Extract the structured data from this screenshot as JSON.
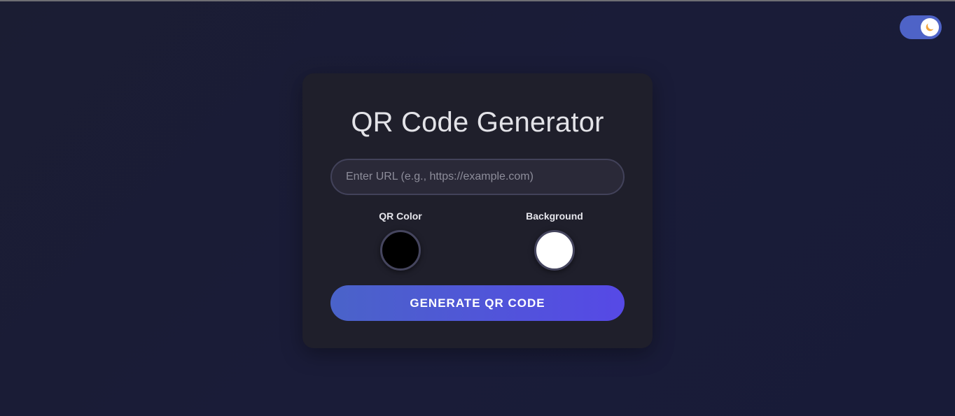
{
  "theme_toggle": {
    "icon": "moon-icon",
    "state": "dark"
  },
  "card": {
    "title": "QR Code Generator",
    "url_input": {
      "placeholder": "Enter URL (e.g., https://example.com)",
      "value": ""
    },
    "qr_color": {
      "label": "QR Color",
      "value": "#000000"
    },
    "background_color": {
      "label": "Background",
      "value": "#ffffff"
    },
    "generate_label": "GENERATE QR CODE"
  },
  "colors": {
    "accent_start": "#4a63c9",
    "accent_end": "#5649e6",
    "card_bg": "#1f1f2b",
    "page_bg": "#1a1c38"
  }
}
